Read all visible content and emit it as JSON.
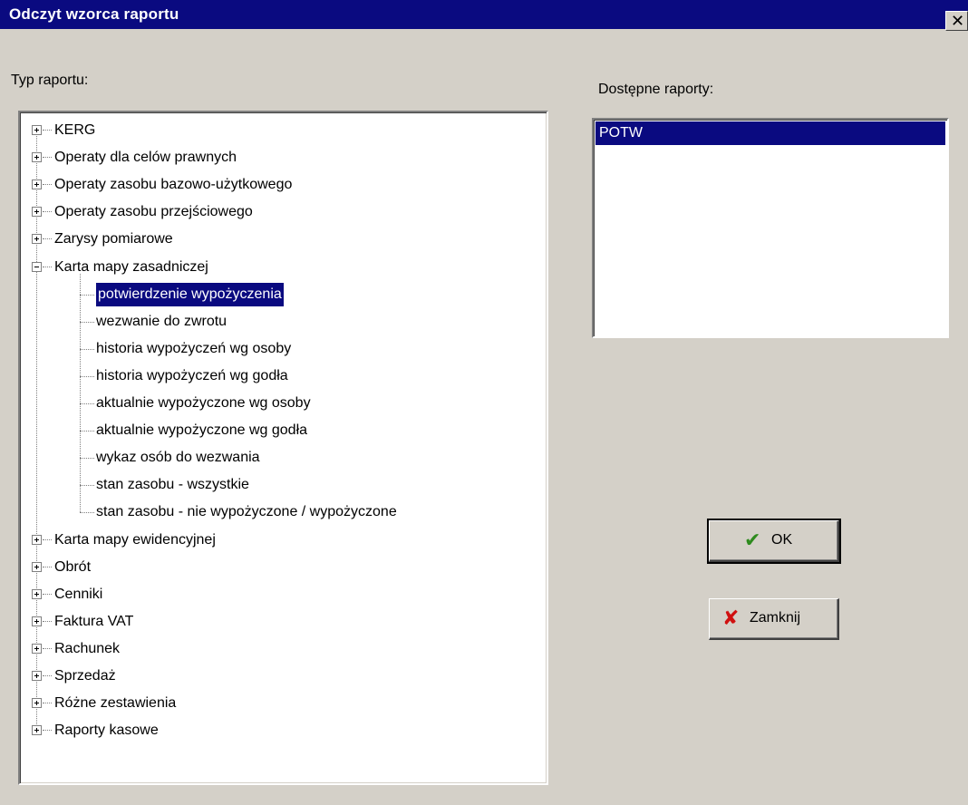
{
  "window": {
    "title": "Odczyt wzorca raportu",
    "close_glyph": "✕"
  },
  "labels": {
    "report_type": "Typ raportu:",
    "available_reports": "Dostępne raporty:"
  },
  "tree": {
    "top_before": [
      "KERG",
      "Operaty dla celów prawnych",
      "Operaty zasobu bazowo-użytkowego",
      "Operaty zasobu przejściowego",
      "Zarysy pomiarowe"
    ],
    "expanded": {
      "label": "Karta mapy zasadniczej",
      "children": [
        "potwierdzenie wypożyczenia",
        "wezwanie do zwrotu",
        "historia wypożyczeń wg osoby",
        "historia wypożyczeń wg godła",
        "aktualnie wypożyczone wg osoby",
        "aktualnie wypożyczone wg godła",
        "wykaz osób do wezwania",
        "stan zasobu - wszystkie",
        "stan zasobu - nie wypożyczone / wypożyczone"
      ],
      "selected_child": "potwierdzenie wypożyczenia"
    },
    "top_after": [
      "Karta mapy ewidencyjnej",
      "Obrót",
      "Cenniki",
      "Faktura VAT",
      "Rachunek",
      "Sprzedaż",
      "Różne zestawienia",
      "Raporty kasowe"
    ]
  },
  "reports": {
    "items": [
      "POTW"
    ],
    "selected": "POTW"
  },
  "buttons": {
    "ok": {
      "label": "OK",
      "icon": "checkmark-icon",
      "color": "#2e8b1e"
    },
    "close": {
      "label": "Zamknij",
      "icon": "red-x-icon",
      "color": "#d01010"
    }
  }
}
